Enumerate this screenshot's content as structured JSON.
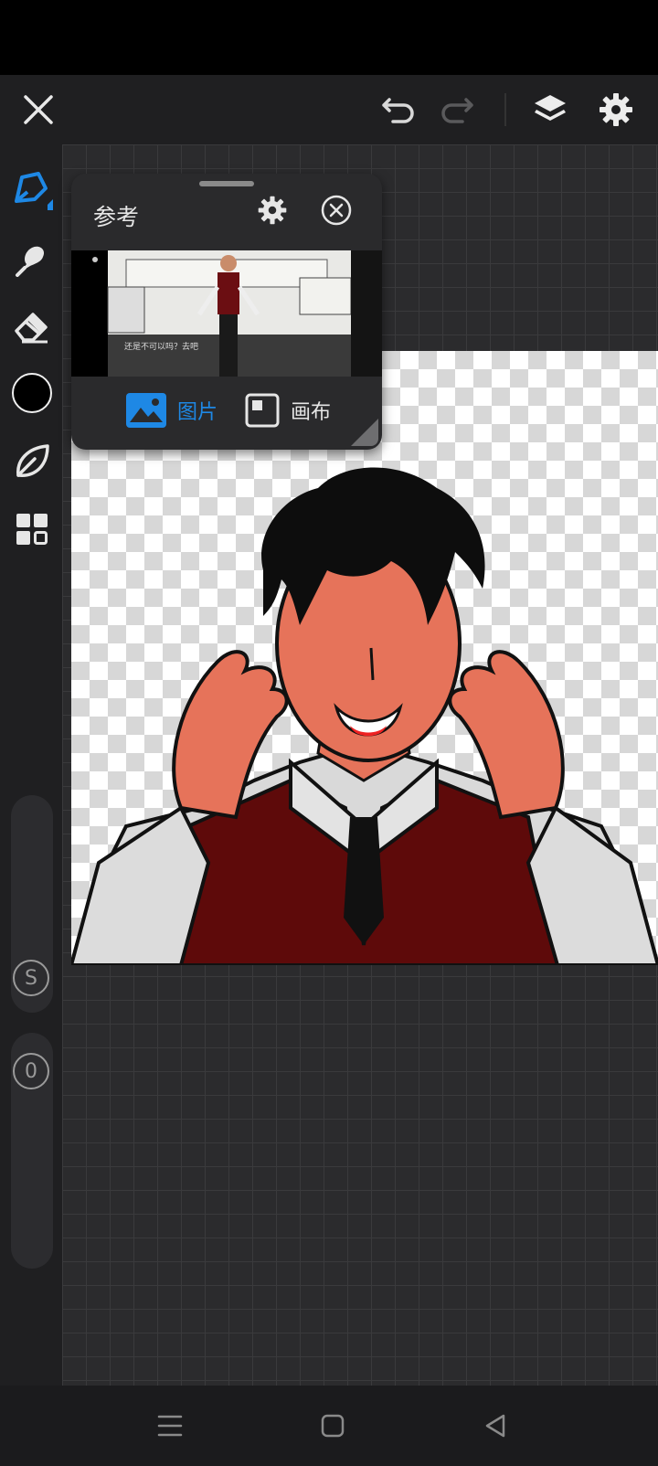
{
  "toolbar": {
    "icons": [
      "close-icon",
      "undo-icon",
      "redo-icon",
      "layers-icon",
      "settings-icon"
    ]
  },
  "tools": [
    "pen-icon",
    "smudge-icon",
    "eraser-icon",
    "color-swatch",
    "leaf-icon",
    "grid-icon"
  ],
  "colors": {
    "accent": "#1e88e5",
    "brush": "#000000"
  },
  "sliders": {
    "size_label": "S",
    "opacity_value": "0"
  },
  "reference": {
    "title": "参考",
    "thumb_caption": "还是不可以吗？去吧",
    "tabs": [
      {
        "label": "图片",
        "active": true
      },
      {
        "label": "画布",
        "active": false
      }
    ]
  },
  "nav": {
    "icons": [
      "menu-icon",
      "home-icon",
      "back-icon"
    ]
  }
}
